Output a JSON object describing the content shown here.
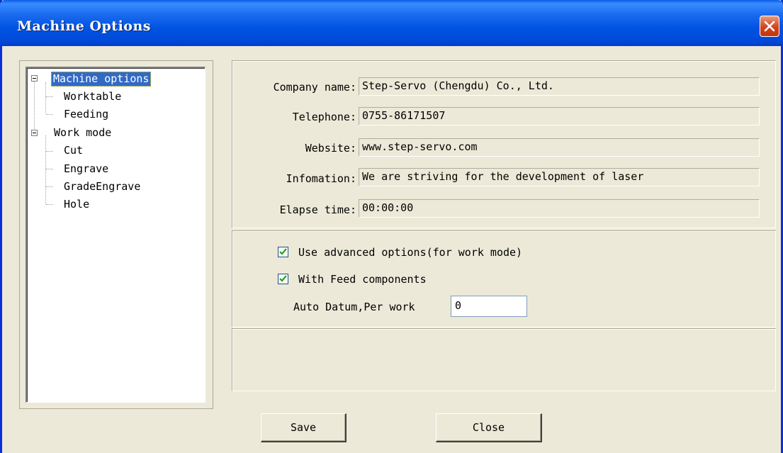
{
  "window": {
    "title": "Machine Options"
  },
  "tree": {
    "items": [
      {
        "label": "Machine options",
        "selected": true,
        "expanded": true
      },
      {
        "label": "Worktable"
      },
      {
        "label": "Feeding"
      },
      {
        "label": "Work mode",
        "expanded": true
      },
      {
        "label": "Cut"
      },
      {
        "label": "Engrave"
      },
      {
        "label": "GradeEngrave"
      },
      {
        "label": "Hole"
      }
    ]
  },
  "info": {
    "company_label": "Company name:",
    "company_value": "Step-Servo (Chengdu) Co., Ltd.",
    "telephone_label": "Telephone:",
    "telephone_value": "0755-86171507",
    "website_label": "Website:",
    "website_value": "www.step-servo.com",
    "information_label": "Infomation:",
    "information_value": "We are striving for the development of laser",
    "elapse_label": "Elapse time:",
    "elapse_value": "00:00:00"
  },
  "options": {
    "advanced_label": "Use advanced options(for work mode)",
    "advanced_checked": true,
    "feed_label": "With Feed components",
    "feed_checked": true,
    "auto_datum_label": "Auto Datum,Per work",
    "auto_datum_value": "0"
  },
  "buttons": {
    "save": "Save",
    "close": "Close"
  },
  "colors": {
    "titlebar": "#0054e3",
    "selection": "#316ac5",
    "dialog_bg": "#ece9d8",
    "close_button": "#d1441d"
  }
}
